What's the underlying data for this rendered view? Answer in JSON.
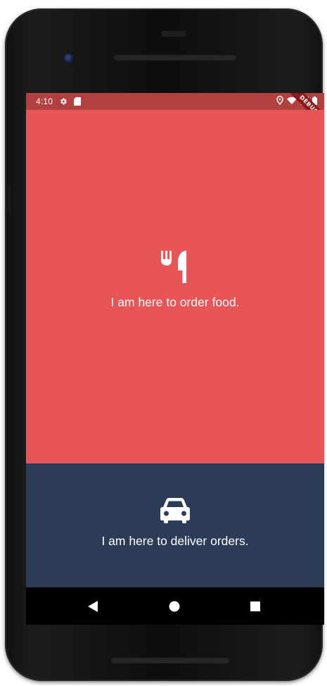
{
  "status_bar": {
    "time": "4:10",
    "icons_left": [
      "settings-icon",
      "sd-card-icon"
    ],
    "icons_right": [
      "location-icon",
      "wifi-icon",
      "signal-icon",
      "battery-icon"
    ],
    "background": "#b2403f"
  },
  "debug_banner": {
    "label": "DEBUG"
  },
  "order_panel": {
    "icon": "restaurant-icon",
    "label": "I am here to order food.",
    "background": "#e85557"
  },
  "deliver_panel": {
    "icon": "car-icon",
    "label": "I am here to deliver orders.",
    "background": "#2d3c56"
  },
  "nav_bar": {
    "buttons": [
      "back-icon",
      "home-icon",
      "recents-icon"
    ]
  }
}
